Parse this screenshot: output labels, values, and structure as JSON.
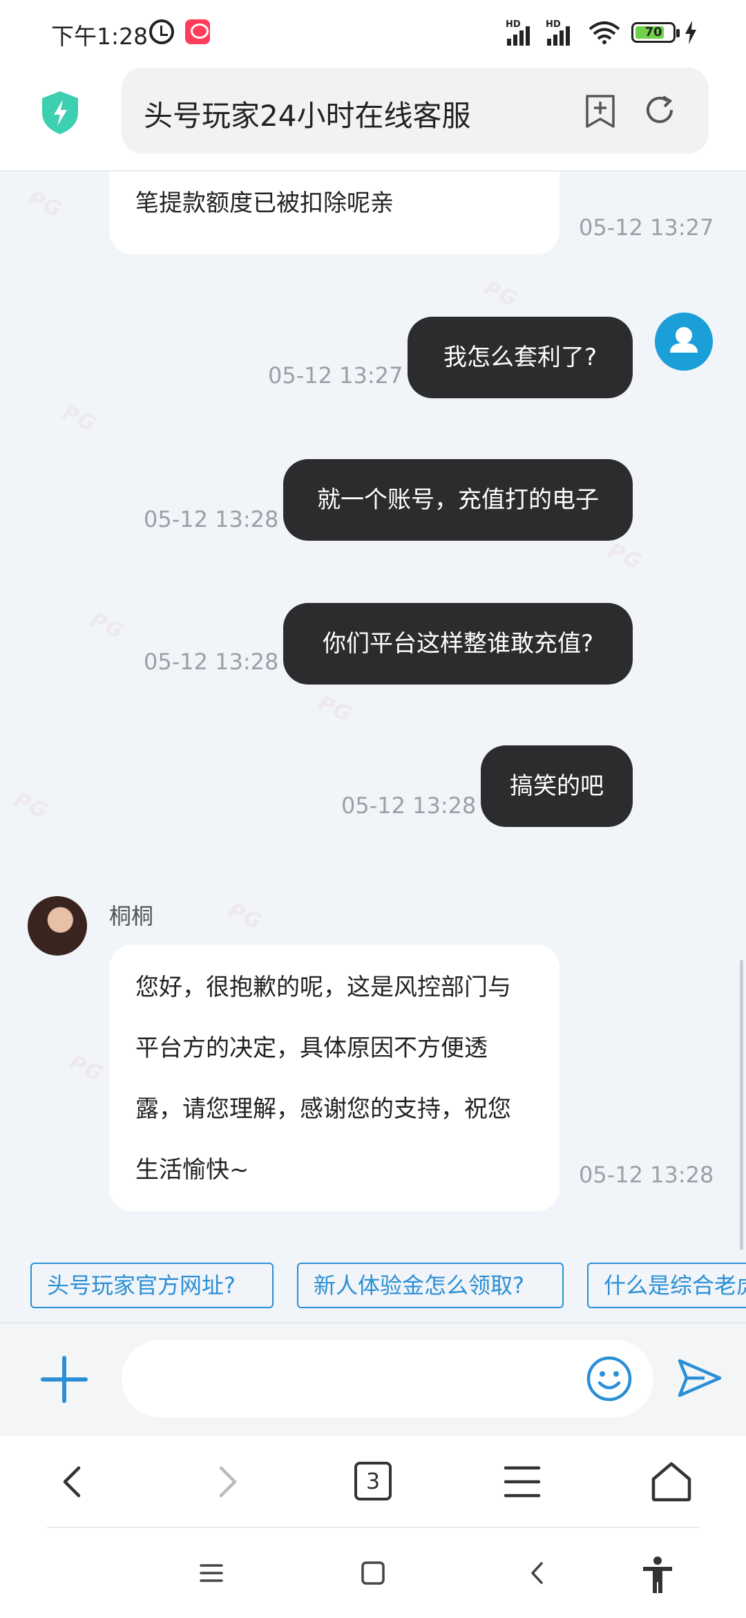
{
  "status_bar": {
    "time": "下午1:28",
    "signal_1": "HD",
    "signal_2": "HD",
    "battery": "70"
  },
  "browser": {
    "title": "头号玩家24小时在线客服",
    "tab_count": "3"
  },
  "chat": {
    "messages": [
      {
        "side": "left",
        "text": "笔提款额度已被扣除呢亲",
        "time": "05-12 13:27"
      },
      {
        "side": "right",
        "text": "我怎么套利了?",
        "time": "05-12 13:27"
      },
      {
        "side": "right",
        "text": "就一个账号，充值打的电子",
        "time": "05-12 13:28"
      },
      {
        "side": "right",
        "text": "你们平台这样整谁敢充值?",
        "time": "05-12 13:28"
      },
      {
        "side": "right",
        "text": "搞笑的吧",
        "time": "05-12 13:28"
      },
      {
        "side": "left",
        "sender": "桐桐",
        "lines": [
          "您好，很抱歉的呢，这是风控部门与",
          "平台方的决定，具体原因不方便透",
          "露，请您理解，感谢您的支持，祝您",
          "生活愉快~"
        ],
        "time": "05-12 13:28"
      }
    ],
    "watermark": "PG"
  },
  "quick_replies": [
    "头号玩家官方网址?",
    "新人体验金怎么领取?",
    "什么是综合老虎"
  ],
  "input": {
    "placeholder": "",
    "value": ""
  },
  "colors": {
    "accent": "#2a8fd6",
    "user_bubble": "#2c2c2e",
    "chat_bg": "#f1f4f8",
    "shield": "#3ccfb0",
    "avatar": "#1a9fd9"
  },
  "icons": [
    "alarm-icon",
    "app-badge-icon",
    "wifi-icon",
    "battery-icon",
    "shield-icon",
    "bookmark-add-icon",
    "reload-icon",
    "plus-icon",
    "emoji-icon",
    "send-icon",
    "back-icon",
    "forward-icon",
    "menu-icon",
    "home-icon",
    "accessibility-icon"
  ]
}
